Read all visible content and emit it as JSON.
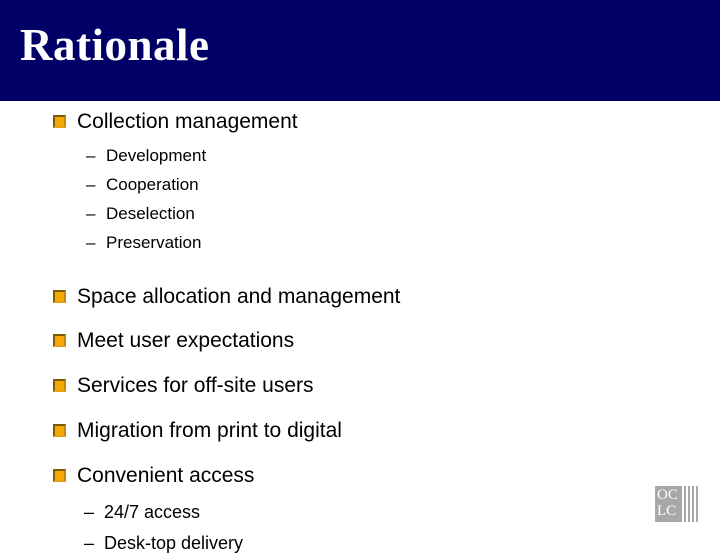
{
  "slide": {
    "title": "Rationale",
    "banner_color": "#000066",
    "background_color": "#ffffff",
    "bullet_marker_color": "#f5a800",
    "text_color": "#000000"
  },
  "content": {
    "bullets": [
      {
        "label": "Collection management",
        "sub": [
          "Development",
          "Cooperation",
          "Deselection",
          "Preservation"
        ]
      },
      {
        "label": "Space allocation and management",
        "sub": []
      },
      {
        "label": "Meet user expectations",
        "sub": []
      },
      {
        "label": "Services for off-site users",
        "sub": []
      },
      {
        "label": "Migration from print to digital",
        "sub": []
      },
      {
        "label": "Convenient access",
        "sub": [
          "24/7 access",
          "Desk-top delivery"
        ]
      }
    ],
    "sub_marker": "–"
  },
  "logo": {
    "line1": "OC",
    "line2": "LC",
    "color": "#a8a8a8"
  }
}
